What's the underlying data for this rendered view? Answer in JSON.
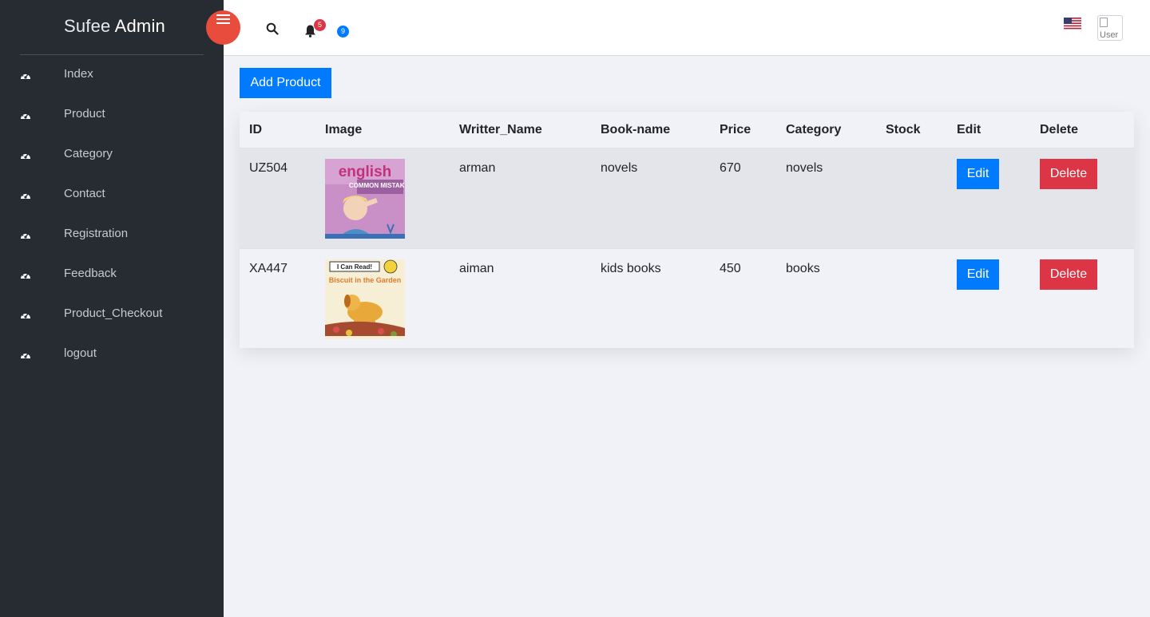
{
  "brand": {
    "light": "Sufee",
    "bold": "Admin"
  },
  "sidebar": {
    "items": [
      {
        "label": "Index",
        "icon": "dashboard-icon"
      },
      {
        "label": "Product",
        "icon": "dashboard-icon"
      },
      {
        "label": "Category",
        "icon": "dashboard-icon"
      },
      {
        "label": "Contact",
        "icon": "dashboard-icon"
      },
      {
        "label": "Registration",
        "icon": "dashboard-icon"
      },
      {
        "label": "Feedback",
        "icon": "dashboard-icon"
      },
      {
        "label": "Product_Checkout",
        "icon": "dashboard-icon"
      },
      {
        "label": "logout",
        "icon": "dashboard-icon"
      }
    ]
  },
  "header": {
    "notifications_count": "5",
    "messages_count": "9",
    "avatar_alt": "User"
  },
  "main": {
    "add_button": "Add Product",
    "table": {
      "columns": [
        "ID",
        "Image",
        "Writter_Name",
        "Book-name",
        "Price",
        "Category",
        "Stock",
        "Edit",
        "Delete"
      ],
      "rows": [
        {
          "id": "UZ504",
          "image": "magazine-cover-english",
          "cover_text_top": "english",
          "cover_text_mid": "COMMON MISTAKES",
          "writer": "arman",
          "book": "novels",
          "price": "670",
          "category": "novels",
          "stock": "",
          "edit": "Edit",
          "delete": "Delete"
        },
        {
          "id": "XA447",
          "image": "book-cover-biscuit",
          "cover_text_top": "I Can Read!",
          "cover_text_mid": "Biscuit in the Garden",
          "writer": "aiman",
          "book": "kids books",
          "price": "450",
          "category": "books",
          "stock": "",
          "edit": "Edit",
          "delete": "Delete"
        }
      ]
    }
  },
  "colors": {
    "sidebar_bg": "#272c33",
    "content_bg": "#f1f2f7",
    "primary": "#007bff",
    "danger": "#dc3545",
    "toggle": "#e74c3c"
  }
}
